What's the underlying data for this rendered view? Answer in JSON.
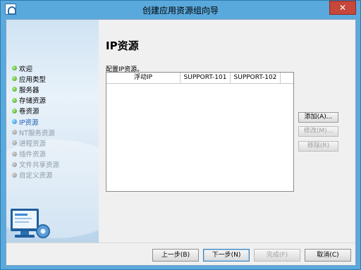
{
  "window": {
    "title": "创建应用资源组向导",
    "close_label": "✕"
  },
  "sidebar": {
    "steps": [
      {
        "label": "欢迎",
        "state": "done"
      },
      {
        "label": "应用类型",
        "state": "done"
      },
      {
        "label": "服务器",
        "state": "done"
      },
      {
        "label": "存储资源",
        "state": "done"
      },
      {
        "label": "卷资源",
        "state": "done"
      },
      {
        "label": "IP资源",
        "state": "current"
      },
      {
        "label": "NT服务资源",
        "state": "pending"
      },
      {
        "label": "进程资源",
        "state": "pending"
      },
      {
        "label": "插件资源",
        "state": "pending"
      },
      {
        "label": "文件共享资源",
        "state": "pending"
      },
      {
        "label": "自定义资源",
        "state": "pending"
      }
    ]
  },
  "main": {
    "title": "IP资源",
    "config_label": "配置IP资源。",
    "table": {
      "columns": [
        "浮动IP",
        "SUPPORT-101",
        "SUPPORT-102"
      ],
      "rows": []
    },
    "buttons": {
      "add": "添加(A)...",
      "edit": "修改(M)...",
      "remove": "移除(R)"
    }
  },
  "footer": {
    "back": "上一步(B)",
    "next": "下一步(N)",
    "finish": "完成(F)",
    "cancel": "取消(C)"
  }
}
